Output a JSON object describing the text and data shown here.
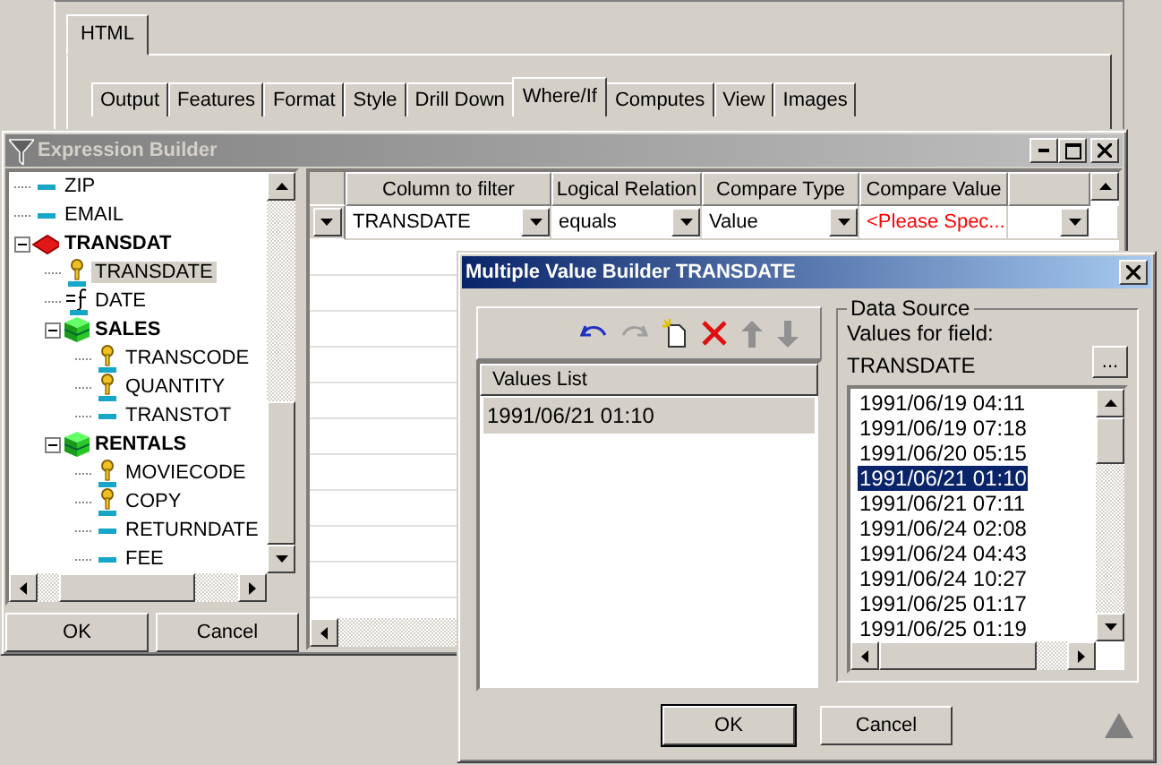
{
  "background_window": {
    "tabs": [
      {
        "label": "HTML",
        "selected": true
      }
    ],
    "subtabs": [
      {
        "label": "Output",
        "selected": false
      },
      {
        "label": "Features",
        "selected": false
      },
      {
        "label": "Format",
        "selected": false
      },
      {
        "label": "Style",
        "selected": false
      },
      {
        "label": "Drill Down",
        "selected": false
      },
      {
        "label": "Where/If",
        "selected": true
      },
      {
        "label": "Computes",
        "selected": false
      },
      {
        "label": "View",
        "selected": false
      },
      {
        "label": "Images",
        "selected": false
      }
    ]
  },
  "expression_builder": {
    "title": "Expression Builder",
    "tree": [
      {
        "label": "ZIP",
        "kind": "field",
        "selected": false
      },
      {
        "label": "EMAIL",
        "kind": "field",
        "selected": false
      },
      {
        "label": "TRANSDAT",
        "kind": "segment",
        "selected": false,
        "expanded": true,
        "children": [
          {
            "label": "TRANSDATE",
            "kind": "key",
            "selected": true
          },
          {
            "label": "DATE",
            "kind": "computed",
            "selected": false
          },
          {
            "label": "SALES",
            "kind": "table",
            "selected": false,
            "expanded": true,
            "children": [
              {
                "label": "TRANSCODE",
                "kind": "key",
                "selected": false
              },
              {
                "label": "QUANTITY",
                "kind": "key",
                "selected": false
              },
              {
                "label": "TRANSTOT",
                "kind": "field",
                "selected": false
              }
            ]
          },
          {
            "label": "RENTALS",
            "kind": "table",
            "selected": false,
            "expanded": true,
            "children": [
              {
                "label": "MOVIECODE",
                "kind": "key",
                "selected": false
              },
              {
                "label": "COPY",
                "kind": "key",
                "selected": false
              },
              {
                "label": "RETURNDATE",
                "kind": "field",
                "selected": false
              },
              {
                "label": "FEE",
                "kind": "field",
                "selected": false
              }
            ]
          }
        ]
      }
    ],
    "buttons": [
      "OK",
      "Cancel"
    ],
    "grid": {
      "columns": [
        "Column to filter",
        "Logical Relation",
        "Compare Type",
        "Compare Value"
      ],
      "rows": [
        {
          "cells": [
            {
              "text": "TRANSDATE",
              "missing": false
            },
            {
              "text": "equals",
              "missing": false
            },
            {
              "text": "Value",
              "missing": false
            },
            {
              "text": "<Please Spec...",
              "missing": true
            }
          ]
        }
      ]
    }
  },
  "multiple_value_builder": {
    "title": "Multiple Value Builder TRANSDATE",
    "values_list": {
      "header": "Values List",
      "items": [
        "1991/06/21 01:10"
      ]
    },
    "data_source": {
      "legend": "Data Source",
      "label": "Values for field:",
      "field": "TRANSDATE",
      "browse_button": "...",
      "items": [
        {
          "text": "1991/06/19 04:11",
          "selected": false
        },
        {
          "text": "1991/06/19 07:18",
          "selected": false
        },
        {
          "text": "1991/06/20 05:15",
          "selected": false
        },
        {
          "text": "1991/06/21 01:10",
          "selected": true
        },
        {
          "text": "1991/06/21 07:11",
          "selected": false
        },
        {
          "text": "1991/06/24 02:08",
          "selected": false
        },
        {
          "text": "1991/06/24 04:43",
          "selected": false
        },
        {
          "text": "1991/06/24 10:27",
          "selected": false
        },
        {
          "text": "1991/06/25 01:17",
          "selected": false
        },
        {
          "text": "1991/06/25 01:19",
          "selected": false
        }
      ]
    },
    "buttons": [
      "OK",
      "Cancel"
    ]
  }
}
